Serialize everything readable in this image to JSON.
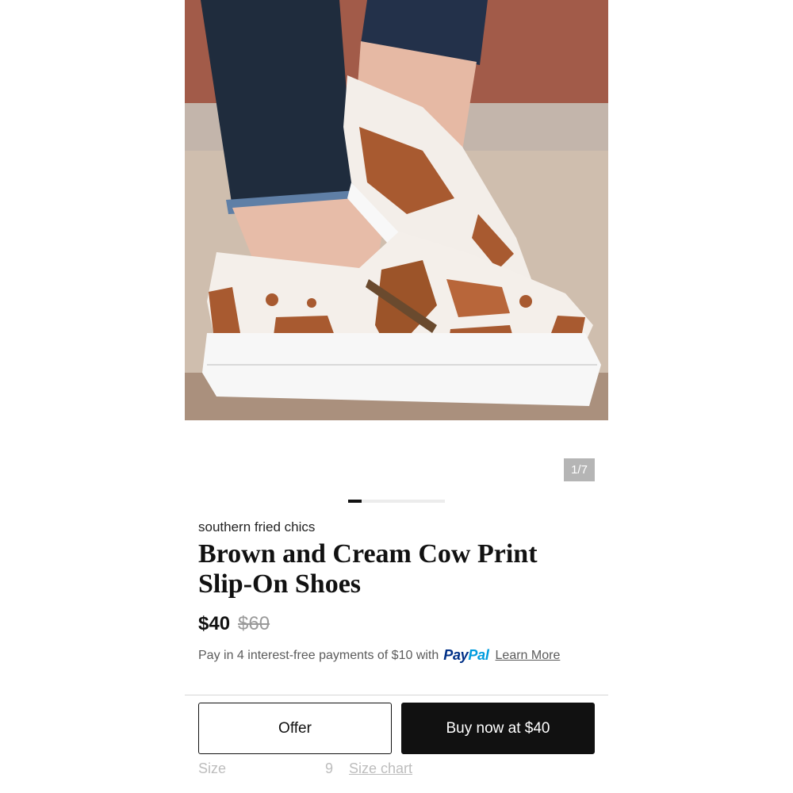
{
  "gallery": {
    "counter": "1/7",
    "current_image": 1,
    "total_images": 7
  },
  "product": {
    "seller": "southern fried chics",
    "title": "Brown and Cream Cow Print Slip-On Shoes",
    "price": "$40",
    "original_price": "$60"
  },
  "payment": {
    "installment_text": "Pay in 4 interest-free payments of $10 with",
    "paypal_part1": "Pay",
    "paypal_part2": "Pal",
    "learn_more": "Learn More"
  },
  "actions": {
    "offer_label": "Offer",
    "buy_label": "Buy now at $40"
  },
  "size": {
    "label": "Size",
    "value": "9",
    "chart_link": "Size chart"
  },
  "colors": {
    "primary": "#111111",
    "paypal_dark": "#003087",
    "paypal_light": "#009cde",
    "counter_bg": "#b5b5b5"
  }
}
